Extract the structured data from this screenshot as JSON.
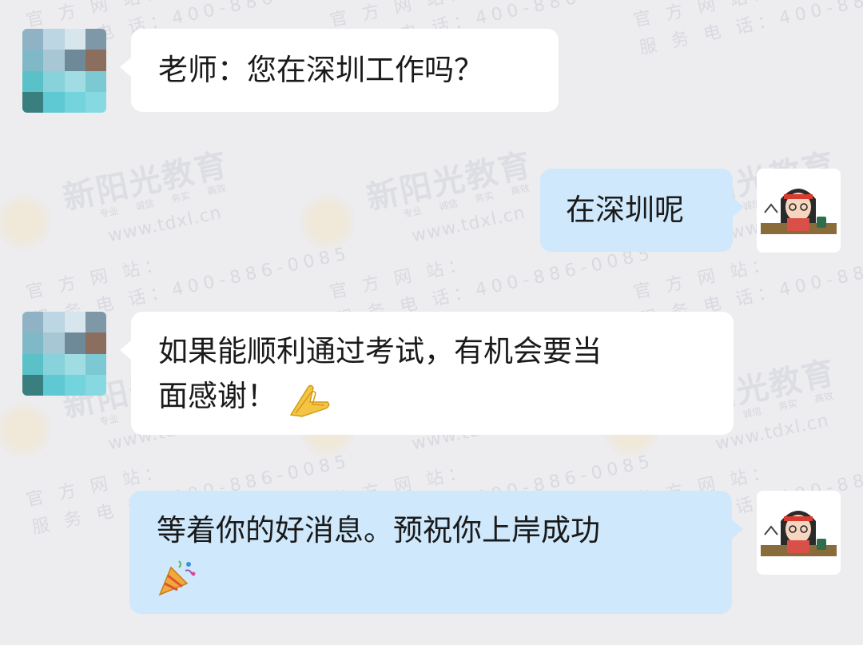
{
  "watermark": {
    "brand": "新阳光教育",
    "tags": "专业 诚信 务实 高效",
    "site": "www.tdxl.cn",
    "line1": "官 方 网 站：",
    "line2": "服 务 电 话：400-886-0085"
  },
  "messages": [
    {
      "sender": "other",
      "text": "老师：您在深圳工作吗？"
    },
    {
      "sender": "self",
      "text": "在深圳呢"
    },
    {
      "sender": "other",
      "text_line1": "如果能顺利通过考试，有机会要当",
      "text_line2": "面感谢！",
      "emoji": "pressed-hands-emoji"
    },
    {
      "sender": "self",
      "text": "等着你的好消息。预祝你上岸成功",
      "emoji": "party-popper-emoji"
    }
  ],
  "colors": {
    "background": "#ededf0",
    "incoming_bubble": "#ffffff",
    "outgoing_bubble": "#cfe8fb"
  }
}
